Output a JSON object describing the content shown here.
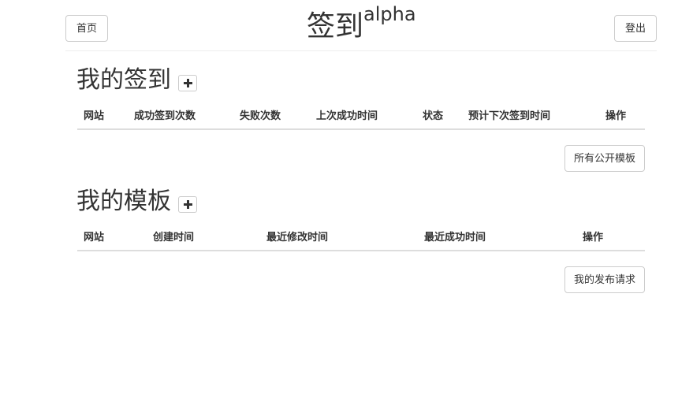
{
  "header": {
    "home_label": "首页",
    "title": "签到",
    "title_sup": "alpha",
    "logout_label": "登出"
  },
  "signins": {
    "title": "我的签到",
    "add_icon": "plus-icon",
    "columns": [
      "网站",
      "成功签到次数",
      "失败次数",
      "上次成功时间",
      "状态",
      "预计下次签到时间",
      "操作"
    ],
    "footer_button": "所有公开模板"
  },
  "templates": {
    "title": "我的模板",
    "add_icon": "plus-icon",
    "columns": [
      "网站",
      "创建时间",
      "最近修改时间",
      "最近成功时间",
      "操作"
    ],
    "footer_button": "我的发布请求"
  }
}
